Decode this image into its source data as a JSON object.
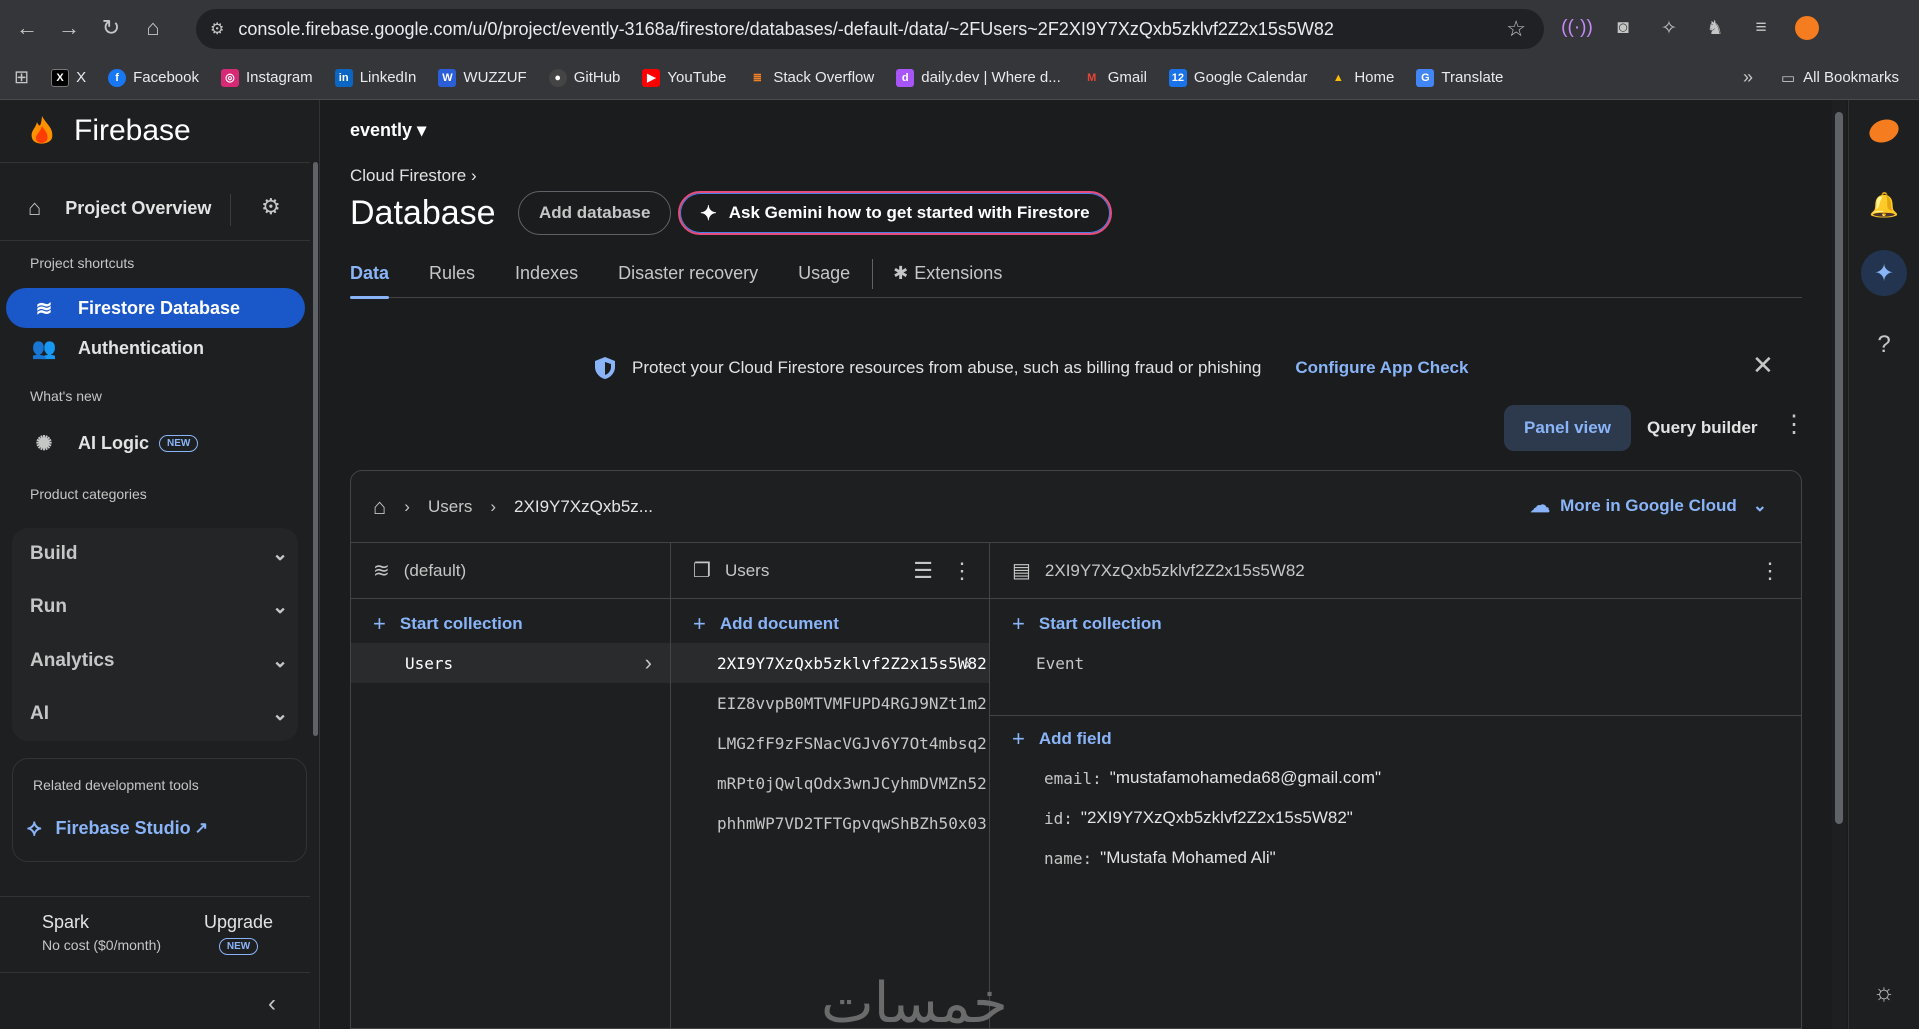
{
  "browser": {
    "url": "console.firebase.google.com/u/0/project/evently-3168a/firestore/databases/-default-/data/~2FUsers~2F2XI9Y7XzQxb5zklvf2Z2x15s5W82",
    "bookmarks": [
      "X",
      "Facebook",
      "Instagram",
      "LinkedIn",
      "WUZZUF",
      "GitHub",
      "YouTube",
      "Stack Overflow",
      "daily.dev | Where d...",
      "Gmail",
      "Google Calendar",
      "Home",
      "Translate"
    ],
    "all_bookmarks": "All Bookmarks"
  },
  "sidebar": {
    "logo": "Firebase",
    "project_overview": "Project Overview",
    "project_shortcuts": "Project shortcuts",
    "firestore": "Firestore Database",
    "authentication": "Authentication",
    "whats_new": "What's new",
    "ai_logic": "AI Logic",
    "new_badge": "NEW",
    "product_categories": "Product categories",
    "categories": [
      "Build",
      "Run",
      "Analytics",
      "AI"
    ],
    "related_tools": "Related development tools",
    "studio": "Firebase Studio",
    "plan_name": "Spark",
    "plan_cost": "No cost ($0/month)",
    "upgrade": "Upgrade"
  },
  "header": {
    "project": "evently",
    "crumb": "Cloud Firestore",
    "title": "Database",
    "add_database": "Add database",
    "gemini": "Ask Gemini how to get started with Firestore"
  },
  "tabs": [
    "Data",
    "Rules",
    "Indexes",
    "Disaster recovery",
    "Usage",
    "Extensions"
  ],
  "banner": {
    "text": "Protect your Cloud Firestore resources from abuse, such as billing fraud or phishing",
    "link": "Configure App Check"
  },
  "view": {
    "panel": "Panel view",
    "query": "Query builder"
  },
  "data": {
    "crumb_collection": "Users",
    "crumb_doc": "2XI9Y7XzQxb5z...",
    "more_cloud": "More in Google Cloud",
    "col1": {
      "title": "(default)",
      "add": "Start collection",
      "items": [
        "Users"
      ]
    },
    "col2": {
      "title": "Users",
      "add": "Add document",
      "items": [
        "2XI9Y7XzQxb5zklvf2Z2x15s5W82",
        "EIZ8vvpB0MTVMFUPD4RGJ9NZt1m2",
        "LMG2fF9zFSNacVGJv6Y7Ot4mbsq2",
        "mRPt0jQwlqOdx3wnJCyhmDVMZn52",
        "phhmWP7VD2TFTGpvqwShBZh50x03"
      ]
    },
    "col3": {
      "title": "2XI9Y7XzQxb5zklvf2Z2x15s5W82",
      "add_collection": "Start collection",
      "subcollection": "Event",
      "add_field": "Add field",
      "fields": [
        {
          "k": "email:",
          "v": "\"mustafamohameda68@gmail.com\""
        },
        {
          "k": "id:",
          "v": "\"2XI9Y7XzQxb5zklvf2Z2x15s5W82\""
        },
        {
          "k": "name:",
          "v": "\"Mustafa Mohamed Ali\""
        }
      ]
    },
    "watermark": "خمسات"
  },
  "colors": {
    "accent": "#8ab4f8",
    "active_nav": "#1a57c8",
    "gemini_border": "#e64c7c"
  }
}
